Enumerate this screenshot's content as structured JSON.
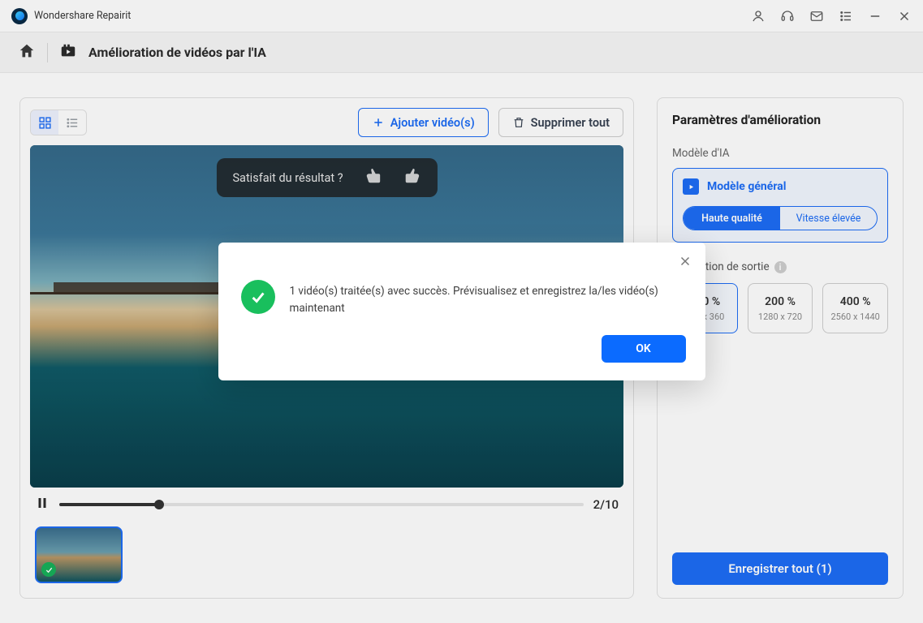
{
  "app": {
    "title": "Wondershare Repairit"
  },
  "breadcrumb": {
    "title": "Amélioration de vidéos par l'IA"
  },
  "toolbar": {
    "add_label": "Ajouter vidéo(s)",
    "delete_label": "Supprimer tout"
  },
  "feedback": {
    "question": "Satisfait du résultat ?"
  },
  "playbar": {
    "counter": "2/10"
  },
  "sidebar": {
    "title": "Paramètres d'amélioration",
    "model_label": "Modèle d'IA",
    "model_name": "Modèle général",
    "quality_hi": "Haute qualité",
    "quality_fast": "Vitesse élevée",
    "output_label": "Résolution de sortie",
    "resolutions": [
      {
        "pct": "100 %",
        "dim": "640 x 360"
      },
      {
        "pct": "200 %",
        "dim": "1280 x 720"
      },
      {
        "pct": "400 %",
        "dim": "2560 x 1440"
      }
    ],
    "save_label": "Enregistrer tout (1)"
  },
  "modal": {
    "message": "1 vidéo(s) traitée(s) avec succès. Prévisualisez et enregistrez la/les vidéo(s) maintenant",
    "ok": "OK"
  },
  "colors": {
    "accent": "#1d6df6",
    "success": "#19bf5d"
  }
}
